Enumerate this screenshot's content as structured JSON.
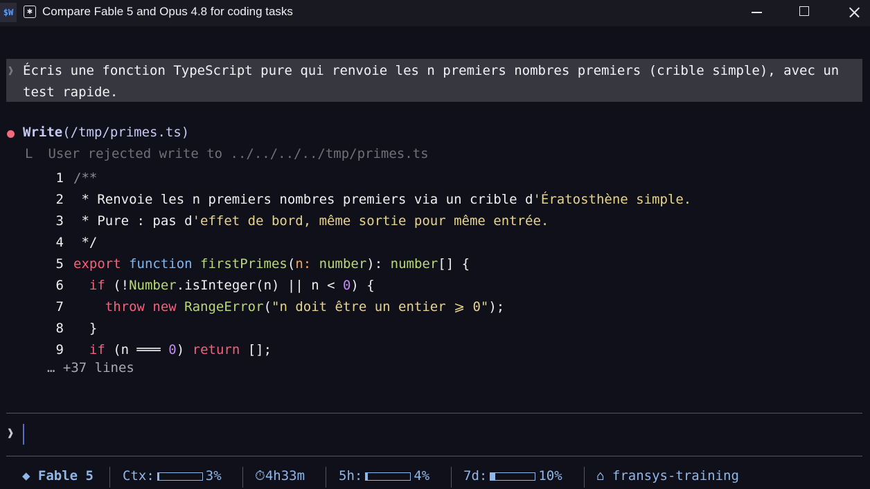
{
  "window": {
    "app_badge": "$W",
    "tab_icon": "✱",
    "title": "Compare Fable 5 and Opus 4.8 for coding tasks"
  },
  "prompt": {
    "caret": "❱",
    "text": "Écris une fonction TypeScript pure qui renvoie les n premiers nombres premiers (crible simple), avec un test rapide."
  },
  "tool_call": {
    "name": "Write",
    "arg": "(/tmp/primes.ts)",
    "elbow": "L",
    "result": "User rejected write to ../../../../tmp/primes.ts"
  },
  "code_lines": [
    {
      "n": "1",
      "parts": [
        {
          "c": "c-comment",
          "t": "/**"
        }
      ]
    },
    {
      "n": "2",
      "parts": [
        {
          "c": "c-text",
          "t": " * Renvoie les n premiers nombres premiers via un crible d"
        },
        {
          "c": "c-yellow",
          "t": "'Ératosthène simple."
        }
      ]
    },
    {
      "n": "3",
      "parts": [
        {
          "c": "c-text",
          "t": " * Pure : pas d"
        },
        {
          "c": "c-yellow",
          "t": "'effet de bord, même sortie pour même entrée."
        }
      ]
    },
    {
      "n": "4",
      "parts": [
        {
          "c": "c-text",
          "t": " */"
        }
      ]
    },
    {
      "n": "5",
      "parts": [
        {
          "c": "c-kw",
          "t": "export "
        },
        {
          "c": "c-fn",
          "t": "function "
        },
        {
          "c": "c-name",
          "t": "firstPrimes"
        },
        {
          "c": "c-text",
          "t": "("
        },
        {
          "c": "c-param",
          "t": "n: "
        },
        {
          "c": "c-type",
          "t": "number"
        },
        {
          "c": "c-text",
          "t": "): "
        },
        {
          "c": "c-type",
          "t": "number"
        },
        {
          "c": "c-text",
          "t": "[] {"
        }
      ]
    },
    {
      "n": "6",
      "parts": [
        {
          "c": "c-text",
          "t": "  "
        },
        {
          "c": "c-kw",
          "t": "if"
        },
        {
          "c": "c-text",
          "t": " (!"
        },
        {
          "c": "c-type",
          "t": "Number"
        },
        {
          "c": "c-text",
          "t": ".isInteger(n) || n < "
        },
        {
          "c": "c-num",
          "t": "0"
        },
        {
          "c": "c-text",
          "t": ") {"
        }
      ]
    },
    {
      "n": "7",
      "parts": [
        {
          "c": "c-text",
          "t": "    "
        },
        {
          "c": "c-kw",
          "t": "throw new "
        },
        {
          "c": "c-name",
          "t": "RangeError"
        },
        {
          "c": "c-text",
          "t": "("
        },
        {
          "c": "c-str",
          "t": "\"n doit être un entier ⩾ 0\""
        },
        {
          "c": "c-text",
          "t": ");"
        }
      ]
    },
    {
      "n": "8",
      "parts": [
        {
          "c": "c-text",
          "t": "  }"
        }
      ]
    },
    {
      "n": "9",
      "parts": [
        {
          "c": "c-text",
          "t": "  "
        },
        {
          "c": "c-kw",
          "t": "if"
        },
        {
          "c": "c-text",
          "t": " (n ═══ "
        },
        {
          "c": "c-num",
          "t": "0"
        },
        {
          "c": "c-text",
          "t": ") "
        },
        {
          "c": "c-kw",
          "t": "return"
        },
        {
          "c": "c-text",
          "t": " [];"
        }
      ]
    }
  ],
  "more_lines": "… +37 lines",
  "input": {
    "caret": "❱",
    "value": ""
  },
  "status": {
    "model_icon": "◆",
    "model": "Fable 5",
    "ctx_label": "Ctx:",
    "ctx_value": "3%",
    "ctx_fraction": 0.03,
    "timer_icon": "⏱",
    "timer": "4h33m",
    "five_h_label": "5h:",
    "five_h_value": "4%",
    "five_h_fraction": 0.04,
    "seven_d_label": "7d:",
    "seven_d_value": "10%",
    "seven_d_fraction": 0.1,
    "home_icon": "⌂",
    "project": "fransys-training"
  }
}
